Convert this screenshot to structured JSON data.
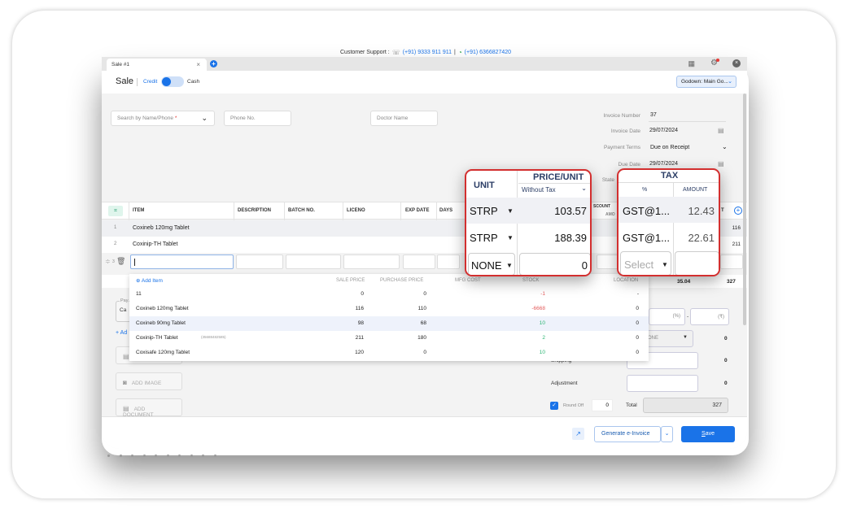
{
  "support": {
    "label": "Customer Support :",
    "phone": "(+91) 9333 911 911",
    "divider": "|",
    "whatsapp": "(+91) 6366827420"
  },
  "tabs": [
    {
      "label": "Sale #1"
    }
  ],
  "header": {
    "title": "Sale",
    "credit_label": "Credit",
    "cash_label": "Cash",
    "godown": "Godown: Main Go..."
  },
  "customer": {
    "search_placeholder": "Search by Name/Phone",
    "required_mark": "*",
    "phone_placeholder": "Phone No.",
    "doctor_placeholder": "Doctor Name"
  },
  "invoice": {
    "number_label": "Invoice Number",
    "number": "37",
    "date_label": "Invoice Date",
    "date": "29/07/2024",
    "terms_label": "Payment Terms",
    "terms": "Due on Receipt",
    "due_label": "Due Date",
    "due": "29/07/2024",
    "state_label": "State"
  },
  "table": {
    "headers": [
      "ITEM",
      "DESCRIPTION",
      "BATCH NO.",
      "LICENO",
      "EXP DATE",
      "DAYS"
    ],
    "discount_header": "SCOUNT",
    "discount_sub": "AMO",
    "amount_header": "T",
    "rows": [
      {
        "num": "1",
        "item": "Coxineb 120mg Tablet",
        "amount": "116"
      },
      {
        "num": "2",
        "item": "Coxinip-TH Tablet",
        "amount": "211"
      }
    ],
    "new_row_num": "3",
    "totals": {
      "tax": "35.04",
      "amount": "327"
    }
  },
  "dropdown": {
    "add_item": "Add Item",
    "columns": [
      "SALE PRICE",
      "PURCHASE PRICE",
      "MFG COST",
      "STOCK",
      "LOCATION"
    ],
    "items": [
      {
        "name": "11",
        "code": "",
        "sale": "0",
        "purchase": "0",
        "stock": "-1",
        "stock_status": "neg",
        "location": "-"
      },
      {
        "name": "Coxineb 120mg Tablet",
        "code": "",
        "sale": "116",
        "purchase": "110",
        "stock": "-6668",
        "stock_status": "neg",
        "location": "0"
      },
      {
        "name": "Coxineb 90mg Tablet",
        "code": "",
        "sale": "98",
        "purchase": "68",
        "stock": "10",
        "stock_status": "pos",
        "location": "0"
      },
      {
        "name": "Coxinip-TH Tablet",
        "code": "(35688482585)",
        "sale": "211",
        "purchase": "180",
        "stock": "2",
        "stock_status": "pos",
        "location": "0"
      },
      {
        "name": "Coxisafe 120mg Tablet",
        "code": "",
        "sale": "120",
        "purchase": "0",
        "stock": "10",
        "stock_status": "pos",
        "location": "0"
      }
    ]
  },
  "left_panel": {
    "payment_label": "Pay",
    "payment_value": "Ca",
    "add_link": "+ Ad",
    "add_image": "ADD IMAGE",
    "add_document": "ADD DOCUMENT"
  },
  "summary": {
    "discount_pct_suffix": "(%)",
    "discount_amt_suffix": "(₹)",
    "dash": "-",
    "tax_select": "ONE",
    "tax_value": "0",
    "shipping_label": "Shipping",
    "shipping_value": "0",
    "adjustment_label": "Adjustment",
    "adjustment_value": "0",
    "round_off_label": "Round Off",
    "round_off_value": "0",
    "round_off_checked": true,
    "total_label": "Total",
    "total": "327"
  },
  "footer": {
    "einvoice": "Generate e-Invoice",
    "save": "Save"
  },
  "callout_unit_price": {
    "unit_header": "UNIT",
    "price_header": "PRICE/UNIT",
    "price_mode": "Without Tax",
    "rows": [
      {
        "unit": "STRP",
        "price": "103.57"
      },
      {
        "unit": "STRP",
        "price": "188.39"
      },
      {
        "unit": "NONE",
        "price": "0"
      }
    ]
  },
  "callout_tax": {
    "header": "TAX",
    "pct_header": "%",
    "amount_header": "AMOUNT",
    "rows": [
      {
        "rate": "GST@1...",
        "amount": "12.43"
      },
      {
        "rate": "GST@1...",
        "amount": "22.61"
      },
      {
        "rate": "Select",
        "amount": ""
      }
    ]
  }
}
